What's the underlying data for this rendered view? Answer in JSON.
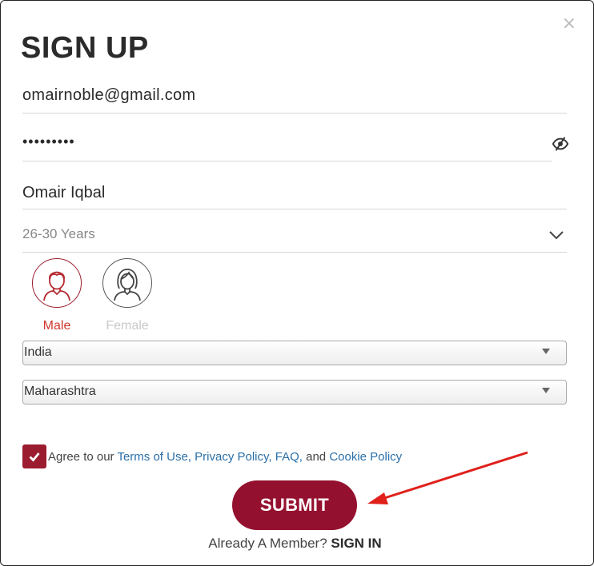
{
  "dialog": {
    "title": "SIGN UP",
    "close_icon": "×"
  },
  "form": {
    "email": "omairnoble@gmail.com",
    "password_masked": "•••••••••",
    "name": "Omair Iqbal",
    "age_range": "26-30 Years",
    "gender": {
      "male_label": "Male",
      "female_label": "Female",
      "selected": "Male"
    },
    "country": "India",
    "state": "Maharashtra"
  },
  "agreement": {
    "checked": true,
    "prefix": "Agree to our ",
    "terms": "Terms of Use,",
    "privacy": "Privacy Policy,",
    "faq": "FAQ,",
    "and": " and ",
    "cookie": "Cookie Policy"
  },
  "actions": {
    "submit_label": "SUBMIT",
    "member_prompt": "Already A Member?",
    "signin_label": "SIGN IN"
  },
  "colors": {
    "brand": "#94102f",
    "selected_gender": "#d0342c",
    "link": "#2a6fa8",
    "annotation_arrow": "#e0201b"
  }
}
